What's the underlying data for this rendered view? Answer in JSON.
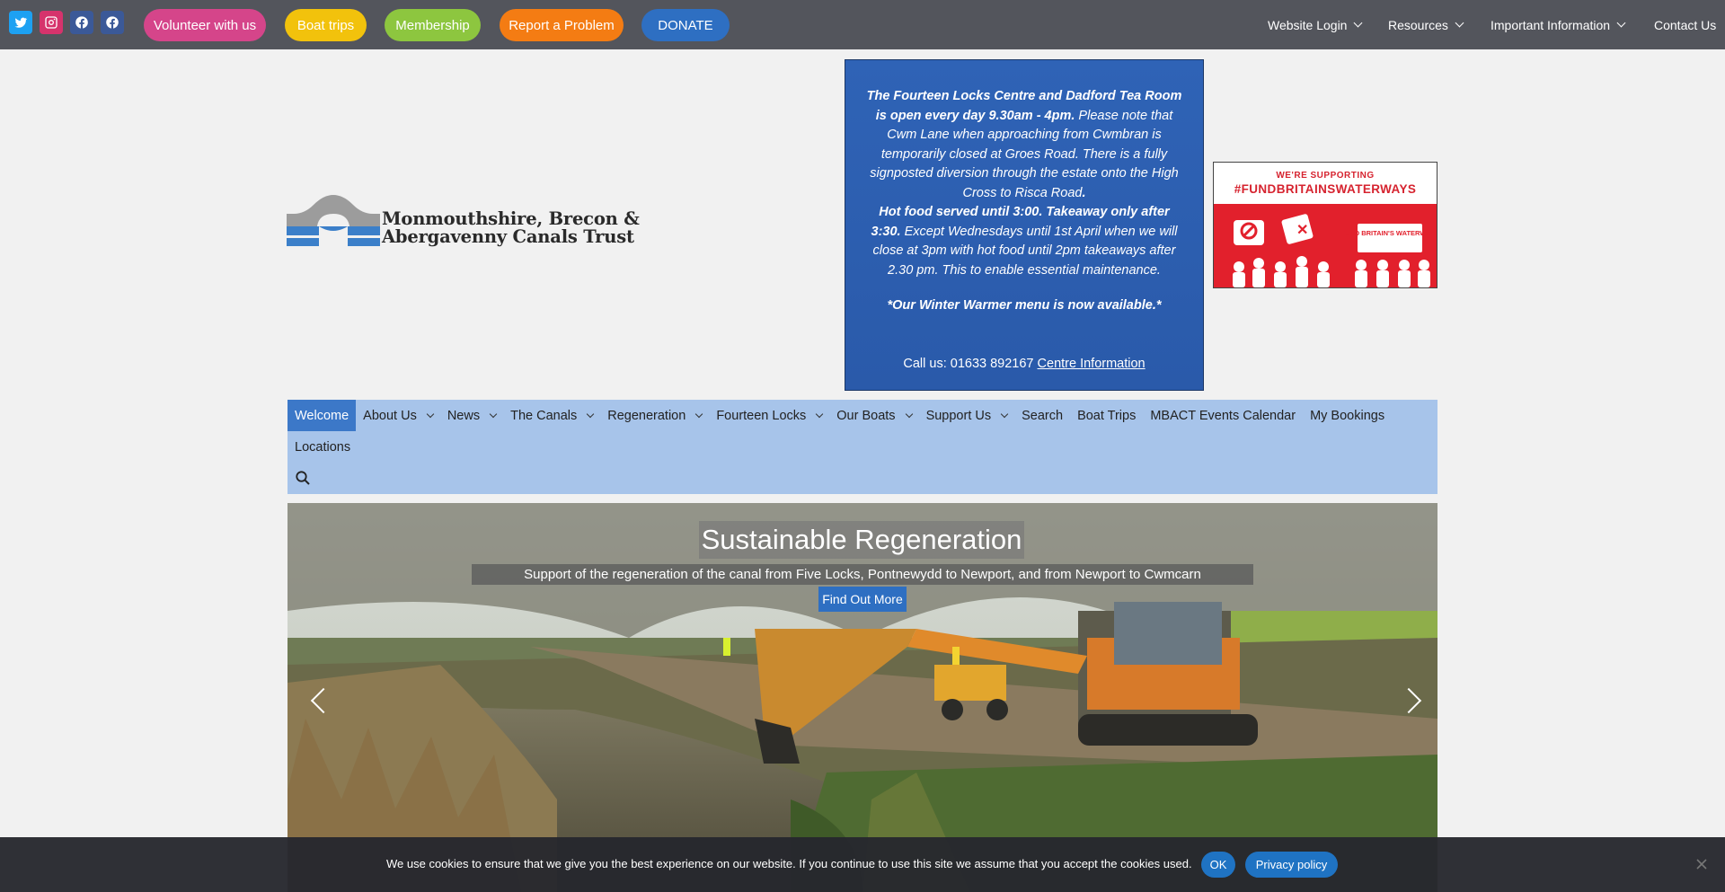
{
  "topbar": {
    "social": [
      {
        "name": "twitter-icon",
        "color": "#1da1f2"
      },
      {
        "name": "instagram-icon",
        "color": "#e1306c"
      },
      {
        "name": "facebook-icon",
        "color": "#3b5998"
      },
      {
        "name": "facebook-icon",
        "color": "#3b5998"
      }
    ],
    "pills": [
      {
        "label": "Volunteer with us",
        "color": "#d5458a"
      },
      {
        "label": "Boat trips",
        "color": "#f2c20c"
      },
      {
        "label": "Membership",
        "color": "#8dc63f"
      },
      {
        "label": "Report a Problem",
        "color": "#f47c13"
      },
      {
        "label": "DONATE",
        "color": "#2e6fc2"
      }
    ],
    "nav": [
      {
        "label": "Website Login",
        "dropdown": true
      },
      {
        "label": "Resources",
        "dropdown": true
      },
      {
        "label": "Important Information",
        "dropdown": true
      },
      {
        "label": "Contact Us",
        "dropdown": false
      }
    ]
  },
  "logo": {
    "line1": "Monmouthshire, Brecon &",
    "line2": "Abergavenny Canals Trust"
  },
  "notice": {
    "p1_bold": "The Fourteen Locks Centre and Dadford Tea Room is open every day 9.30am - 4pm.",
    "p1_rest": "  Please note that Cwm Lane when approaching from Cwmbran is temporarily closed at Groes Road.  There is a fully signposted diversion through the estate onto the High Cross to Risca Road",
    "p1_end": ".",
    "p2_bold": "Hot food served  until 3:00. Takeaway only after 3:30.",
    "p2_rest": " Except Wednesdays until 1st April when we will close at 3pm with hot food until 2pm takeaways after 2.30 pm. This to enable essential maintenance.",
    "p3_bold": "*Our  Winter Warmer menu is now available.*",
    "call_text": "Call us: 01633 892167 ",
    "call_link": "Centre Information"
  },
  "banner": {
    "line1": "WE'RE SUPPORTING",
    "line2": "#FUNDBRITAINSWATERWAYS",
    "sign": "FUND BRITAIN'S WATERWAYS"
  },
  "mainnav": {
    "row1": [
      {
        "label": "Welcome",
        "dropdown": false,
        "active": true
      },
      {
        "label": "About Us",
        "dropdown": true
      },
      {
        "label": "News",
        "dropdown": true
      },
      {
        "label": "The Canals",
        "dropdown": true
      },
      {
        "label": "Regeneration",
        "dropdown": true
      },
      {
        "label": "Fourteen Locks",
        "dropdown": true
      },
      {
        "label": "Our Boats",
        "dropdown": true
      },
      {
        "label": "Support Us",
        "dropdown": true
      },
      {
        "label": "Search",
        "dropdown": false
      },
      {
        "label": "Boat Trips",
        "dropdown": false
      },
      {
        "label": "MBACT Events Calendar",
        "dropdown": false
      },
      {
        "label": "My Bookings",
        "dropdown": false
      }
    ],
    "row2": [
      {
        "label": "Locations",
        "dropdown": false
      }
    ]
  },
  "slider": {
    "title": "Sustainable Regeneration",
    "subtitle": "Support of the regeneration of the canal from Five Locks, Pontnewydd to Newport, and from Newport to Cwmcarn",
    "button": "Find Out More"
  },
  "cookie": {
    "text": "We use cookies to ensure that we give you the best experience on our website. If you continue to use this site we assume that you accept the cookies used.",
    "ok": "OK",
    "privacy": "Privacy policy"
  }
}
